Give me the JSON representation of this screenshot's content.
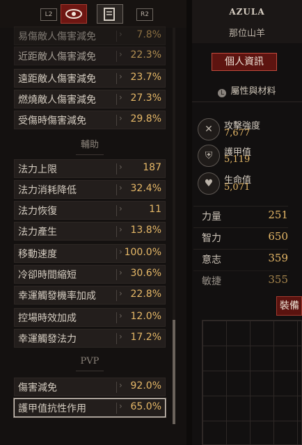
{
  "tabs": {
    "left_key": "L2",
    "right_key": "R2",
    "active_icon": "eye-icon",
    "alt_icon": "scroll-icon"
  },
  "rows_top": [
    {
      "label": "易傷敵人傷害減免",
      "value": "7.8%"
    },
    {
      "label": "近距敵人傷害減免",
      "value": "22.3%"
    },
    {
      "label": "遠距敵人傷害減免",
      "value": "23.7%"
    },
    {
      "label": "燃燒敵人傷害減免",
      "value": "27.3%"
    },
    {
      "label": "受傷時傷害減免",
      "value": "29.8%"
    }
  ],
  "section_utility": "輔助",
  "rows_utility": [
    {
      "label": "法力上限",
      "value": "187"
    },
    {
      "label": "法力消耗降低",
      "value": "32.4%"
    },
    {
      "label": "法力恢復",
      "value": "11"
    },
    {
      "label": "法力產生",
      "value": "13.8%"
    },
    {
      "label": "移動速度",
      "value": "100.0%"
    },
    {
      "label": "冷卻時間縮短",
      "value": "30.6%"
    },
    {
      "label": "幸運觸發機率加成",
      "value": "22.8%"
    },
    {
      "label": "控場時效加成",
      "value": "12.0%"
    },
    {
      "label": "幸運觸發法力",
      "value": "17.2%"
    }
  ],
  "section_pvp": "PVP",
  "rows_pvp": [
    {
      "label": "傷害減免",
      "value": "92.0%"
    },
    {
      "label": "護甲值抗性作用",
      "value": "65.0%"
    }
  ],
  "character": {
    "name": "AZULA",
    "title": "那位山羊"
  },
  "profile_button": "個人資訊",
  "attributes_label": "屬性與材料",
  "stats": [
    {
      "label": "攻擊強度",
      "value": "7,677",
      "icon": "swords-icon"
    },
    {
      "label": "護甲值",
      "value": "5,119",
      "icon": "shield-icon"
    },
    {
      "label": "生命值",
      "value": "5,071",
      "icon": "heart-icon"
    }
  ],
  "core": [
    {
      "label": "力量",
      "value": "251"
    },
    {
      "label": "智力",
      "value": "650"
    },
    {
      "label": "意志",
      "value": "359"
    },
    {
      "label": "敏捷",
      "value": "355"
    }
  ],
  "equipment_button": "裝備"
}
